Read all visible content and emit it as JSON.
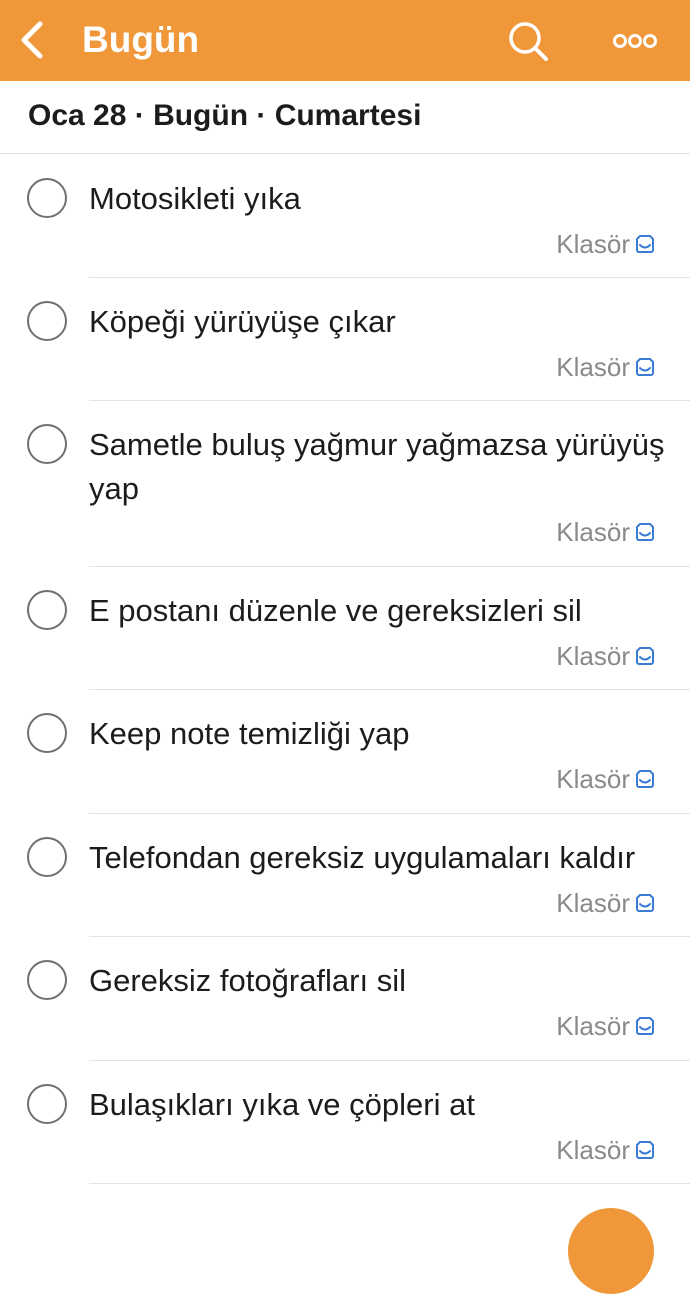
{
  "navbar": {
    "title": "Bugün",
    "color": "#f0973a",
    "icons": [
      "chevron-left-icon",
      "search-icon",
      "more-dots-icon"
    ]
  },
  "date_header": "Oca 28 · Bugün · Cumartesi",
  "tasks": [
    {
      "title": "Motosikleti yıka",
      "folder": "Klasör"
    },
    {
      "title": "Köpeği yürüyüşe çıkar",
      "folder": "Klasör"
    },
    {
      "title": "Sametle buluş yağmur yağmazsa yürüyüş yap",
      "folder": "Klasör"
    },
    {
      "title": "E postanı düzenle ve gereksizleri sil",
      "folder": "Klasör"
    },
    {
      "title": "Keep note temizliği yap",
      "folder": "Klasör"
    },
    {
      "title": "Telefondan gereksiz uygulamaları kaldır",
      "folder": "Klasör"
    },
    {
      "title": "Gereksiz fotoğrafları sil",
      "folder": "Klasör"
    },
    {
      "title": "Bulaşıkları yıka ve çöpleri at",
      "folder": "Klasör"
    }
  ],
  "folder_icon": "inbox-tray-icon",
  "folder_icon_color": "#3a7bd5"
}
